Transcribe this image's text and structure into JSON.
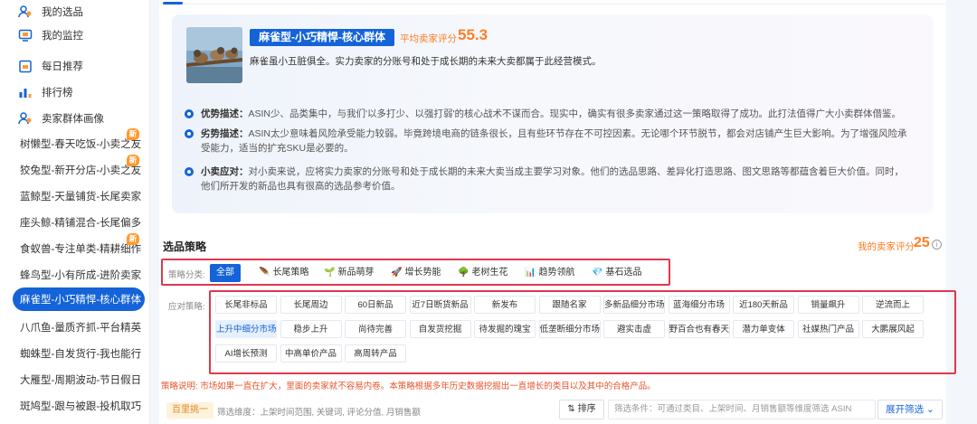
{
  "sidebar": {
    "top_items": [
      {
        "label": "我的选品",
        "icon": "users-icon"
      },
      {
        "label": "我的监控",
        "icon": "monitor-icon"
      },
      {
        "label": "每日推荐",
        "icon": "calendar-icon"
      },
      {
        "label": "排行榜",
        "icon": "ranking-icon"
      },
      {
        "label": "卖家群体画像",
        "icon": "users-icon"
      }
    ],
    "sub_items": [
      {
        "label": "树懒型-春天吃饭-小卖之友",
        "badge": "新"
      },
      {
        "label": "狡兔型-新开分店-小卖之友",
        "badge": "新"
      },
      {
        "label": "蓝鲸型-天量铺货-长尾卖家",
        "badge": ""
      },
      {
        "label": "座头鲸-精铺混合-长尾偏多",
        "badge": ""
      },
      {
        "label": "食蚁兽-专注单类-精耕细作",
        "badge": "新"
      },
      {
        "label": "蜂鸟型-小有所成-进阶卖家",
        "badge": ""
      },
      {
        "label": "麻雀型-小巧精悍-核心群体",
        "badge": "",
        "active": true
      },
      {
        "label": "八爪鱼-量质齐抓-平台精英",
        "badge": ""
      },
      {
        "label": "蜘蛛型-自发货行-我也能行",
        "badge": ""
      },
      {
        "label": "大雁型-周期波动-节日假日",
        "badge": ""
      },
      {
        "label": "斑鸠型-跟与被跟-投机取巧",
        "badge": ""
      }
    ]
  },
  "intro": {
    "type_name": "麻雀型-小巧精悍-核心群体",
    "avg_score_label": "平均卖家评分",
    "avg_score": "55.3",
    "summary": "麻雀虽小五脏俱全。实力卖家的分账号和处于成长期的未来大卖都属于此经营模式。",
    "descs": [
      {
        "title": "优势描述：",
        "text": "ASIN少、品类集中，与我们'以多打少、以强打弱'的核心战术不谋而合。现实中，确实有很多卖家通过这一策略取得了成功。此打法值得广大小卖群体借鉴。"
      },
      {
        "title": "劣势描述：",
        "text": "ASIN太少意味着风险承受能力较弱。毕竟跨境电商的链条很长，且有些环节存在不可控因素。无论哪个环节脱节，都会对店铺产生巨大影响。为了增强风险承受能力，适当的扩充SKU是必要的。"
      },
      {
        "title": "小卖应对：",
        "text": "对小卖来说，应将实力卖家的分账号和处于成长期的未来大卖当成主要学习对象。他们的选品思路、差异化打造思路、图文思路等都蕴含着巨大价值。同时，他们所开发的新品也具有很高的选品参考价值。"
      }
    ]
  },
  "strategy": {
    "section_title": "选品策略",
    "my_score_label": "我的卖家评分",
    "my_score": "25",
    "info_glyph": "i",
    "category_label": "策略分类:",
    "categories": [
      {
        "label": "全部",
        "icon": "",
        "active": true
      },
      {
        "label": "长尾策略",
        "icon": "feather-icon",
        "glyph": "🪶"
      },
      {
        "label": "新品萌芽",
        "icon": "sprout-icon",
        "glyph": "🌱"
      },
      {
        "label": "增长势能",
        "icon": "rocket-icon",
        "glyph": "🚀"
      },
      {
        "label": "老树生花",
        "icon": "tree-icon",
        "glyph": "🌳"
      },
      {
        "label": "趋势领航",
        "icon": "chart-icon",
        "glyph": "📊"
      },
      {
        "label": "基石选品",
        "icon": "gem-icon",
        "glyph": "💎"
      }
    ],
    "strategy_label": "应对策略:",
    "strategies": [
      [
        "长尾非标品",
        "长尾周边",
        "60日新品",
        "近7日断货新品",
        "新发布",
        "跟随名家",
        "多新品细分市场",
        "蓝海细分市场",
        "近180天新品",
        "销量飙升",
        "逆流而上"
      ],
      [
        "上升中细分市场",
        "稳步上升",
        "尚待完善",
        "自发货挖掘",
        "待发掘的瑰宝",
        "低垄断细分市场",
        "避实击虚",
        "野百合也有春天",
        "潜力单变体",
        "社媒热门产品",
        "大鹏展风起"
      ],
      [
        "AI增长预测",
        "中高单价产品",
        "高周转产品"
      ]
    ],
    "selected_strategy": "上升中细分市场",
    "note": "策略说明: 市场如果一直在扩大，里面的卖家就不容易内卷。本策略根据多年历史数据挖掘出一直增长的类目以及其中的合格产品。"
  },
  "filter": {
    "select_label": "百里挑一",
    "hint": "筛选维度：上架时间范围, 关键词, 评论分值, 月销售额",
    "sort_label": "排序",
    "input_placeholder": "筛选条件：可通过类目、上架时间、月销售额等维度筛选 ASIN",
    "expand_label": "展开筛选"
  },
  "colors": {
    "accent": "#1463d8",
    "orange": "#ff7d24",
    "highlight_border": "#e0384c"
  }
}
